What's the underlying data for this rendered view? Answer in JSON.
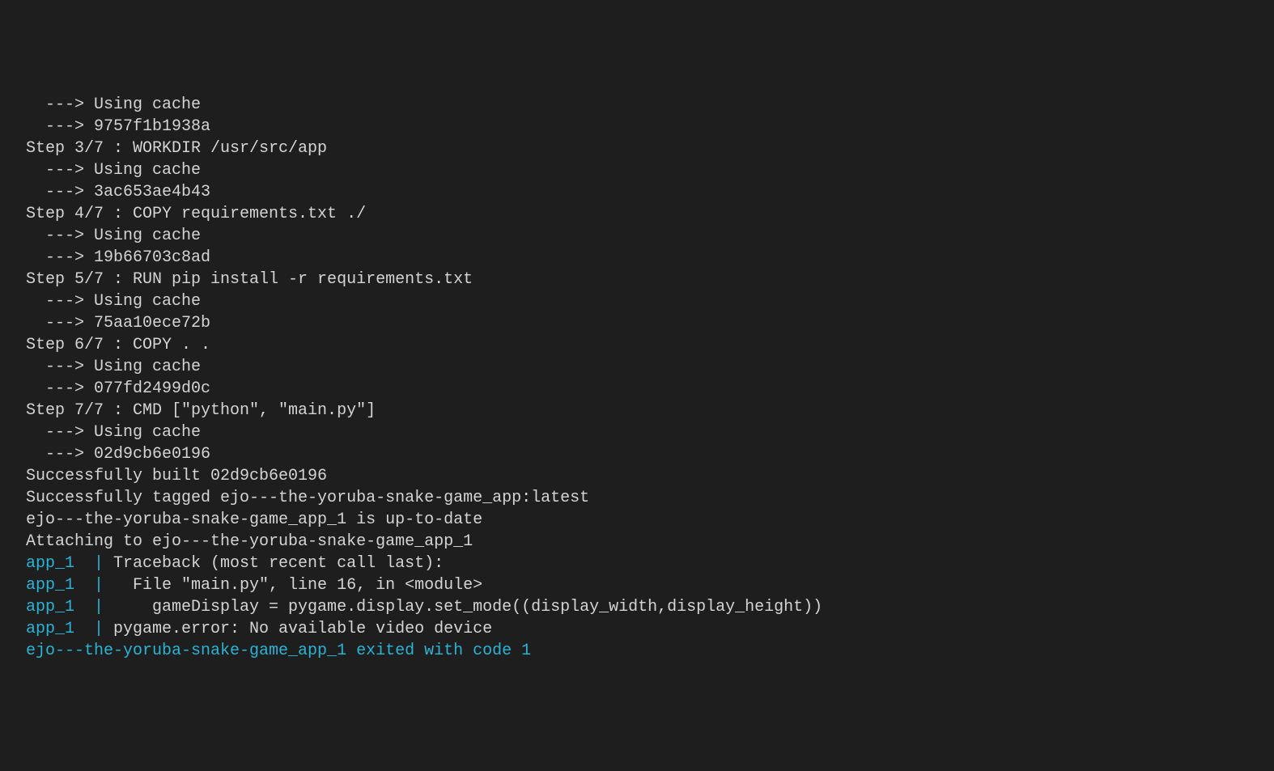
{
  "lines": [
    {
      "indent": "arrow",
      "text": " ---> Using cache"
    },
    {
      "indent": "arrow",
      "text": " ---> 9757f1b1938a"
    },
    {
      "indent": "step",
      "text": "Step 3/7 : WORKDIR /usr/src/app"
    },
    {
      "indent": "arrow",
      "text": " ---> Using cache"
    },
    {
      "indent": "arrow",
      "text": " ---> 3ac653ae4b43"
    },
    {
      "indent": "step",
      "text": "Step 4/7 : COPY requirements.txt ./"
    },
    {
      "indent": "arrow",
      "text": " ---> Using cache"
    },
    {
      "indent": "arrow",
      "text": " ---> 19b66703c8ad"
    },
    {
      "indent": "step",
      "text": "Step 5/7 : RUN pip install -r requirements.txt"
    },
    {
      "indent": "arrow",
      "text": " ---> Using cache"
    },
    {
      "indent": "arrow",
      "text": " ---> 75aa10ece72b"
    },
    {
      "indent": "step",
      "text": "Step 6/7 : COPY . ."
    },
    {
      "indent": "arrow",
      "text": " ---> Using cache"
    },
    {
      "indent": "arrow",
      "text": " ---> 077fd2499d0c"
    },
    {
      "indent": "step",
      "text": "Step 7/7 : CMD [\"python\", \"main.py\"]"
    },
    {
      "indent": "arrow",
      "text": " ---> Using cache"
    },
    {
      "indent": "arrow",
      "text": " ---> 02d9cb6e0196"
    },
    {
      "indent": "step",
      "text": "Successfully built 02d9cb6e0196"
    },
    {
      "indent": "step",
      "text": "Successfully tagged ejo---the-yoruba-snake-game_app:latest"
    },
    {
      "indent": "step",
      "text": "ejo---the-yoruba-snake-game_app_1 is up-to-date"
    },
    {
      "indent": "step",
      "text": "Attaching to ejo---the-yoruba-snake-game_app_1"
    }
  ],
  "log_lines": [
    {
      "prefix": "app_1  |",
      "body": " Traceback (most recent call last):"
    },
    {
      "prefix": "app_1  |",
      "body": "   File \"main.py\", line 16, in <module>"
    },
    {
      "prefix": "app_1  |",
      "body": "     gameDisplay = pygame.display.set_mode((display_width,display_height))"
    },
    {
      "prefix": "app_1  |",
      "body": " pygame.error: No available video device"
    }
  ],
  "exit_line": "ejo---the-yoruba-snake-game_app_1 exited with code 1"
}
